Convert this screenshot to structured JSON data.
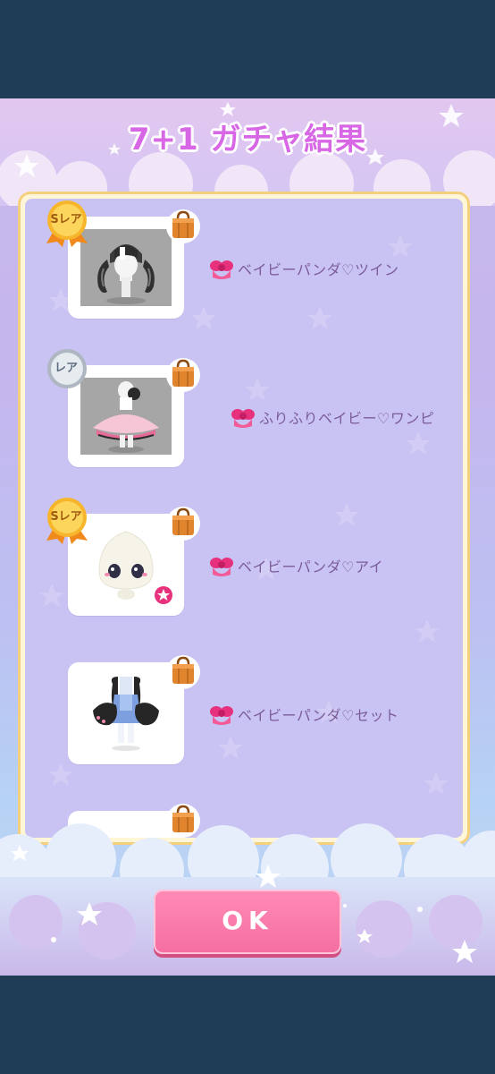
{
  "dialog": {
    "title": "7+1 ガチャ結果",
    "ok_label": "OK"
  },
  "results": [
    {
      "rarity": "Sレア",
      "rarity_tier": "gold",
      "name": "ベイビーパンダ♡ツイン",
      "category": "hair",
      "new_item": false
    },
    {
      "rarity": "レア",
      "rarity_tier": "silver",
      "name": "ふりふりベイビー♡ワンピ",
      "category": "dress",
      "new_item": false
    },
    {
      "rarity": "Sレア",
      "rarity_tier": "gold",
      "name": "ベイビーパンダ♡アイ",
      "category": "eyes",
      "new_item": true
    },
    {
      "rarity": "",
      "rarity_tier": "none",
      "name": "ベイビーパンダ♡セット",
      "category": "set",
      "new_item": false
    },
    {
      "rarity": "",
      "rarity_tier": "none",
      "name": "",
      "category": "partial",
      "new_item": false
    }
  ],
  "icons": {
    "bag": "shopping-bag-icon",
    "category": "pink-bow-icon",
    "favorite": "star-sticker-icon"
  },
  "colors": {
    "title": "#d867e6",
    "panel_border": "#f4cf7d",
    "ok_button": "#f56fa2",
    "item_text": "#7b5c98"
  }
}
